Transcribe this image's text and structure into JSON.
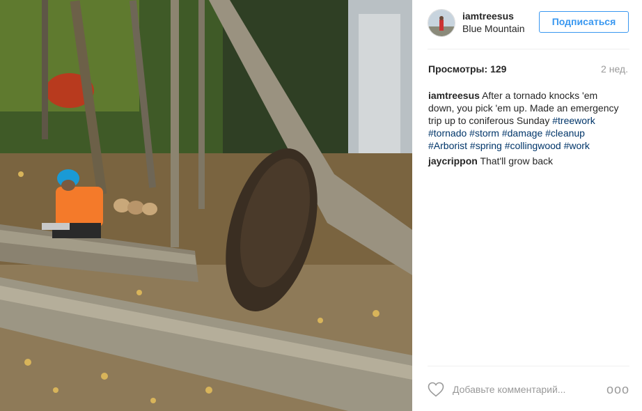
{
  "post": {
    "username": "iamtreesus",
    "location": "Blue Mountain",
    "follow_label": "Подписаться",
    "views_label": "Просмотры:",
    "views_count": "129",
    "time_ago": "2 нед.",
    "caption": {
      "username": "iamtreesus",
      "text": "After a tornado knocks 'em down, you pick 'em up. Made an emergency trip up to coniferous Sunday",
      "hashtags": [
        "#treework",
        "#tornado",
        "#storm",
        "#damage",
        "#cleanup",
        "#Arborist",
        "#spring",
        "#collingwood",
        "#work"
      ]
    },
    "comments": [
      {
        "username": "jaycrippon",
        "text": "That'll grow back"
      }
    ],
    "add_comment_placeholder": "Добавьте комментарий...",
    "more_label": "ooo"
  },
  "icons": {
    "like": "heart-icon",
    "more": "more-options-icon"
  },
  "colors": {
    "accent": "#3897f0",
    "hashtag": "#003569",
    "muted": "#999999"
  }
}
